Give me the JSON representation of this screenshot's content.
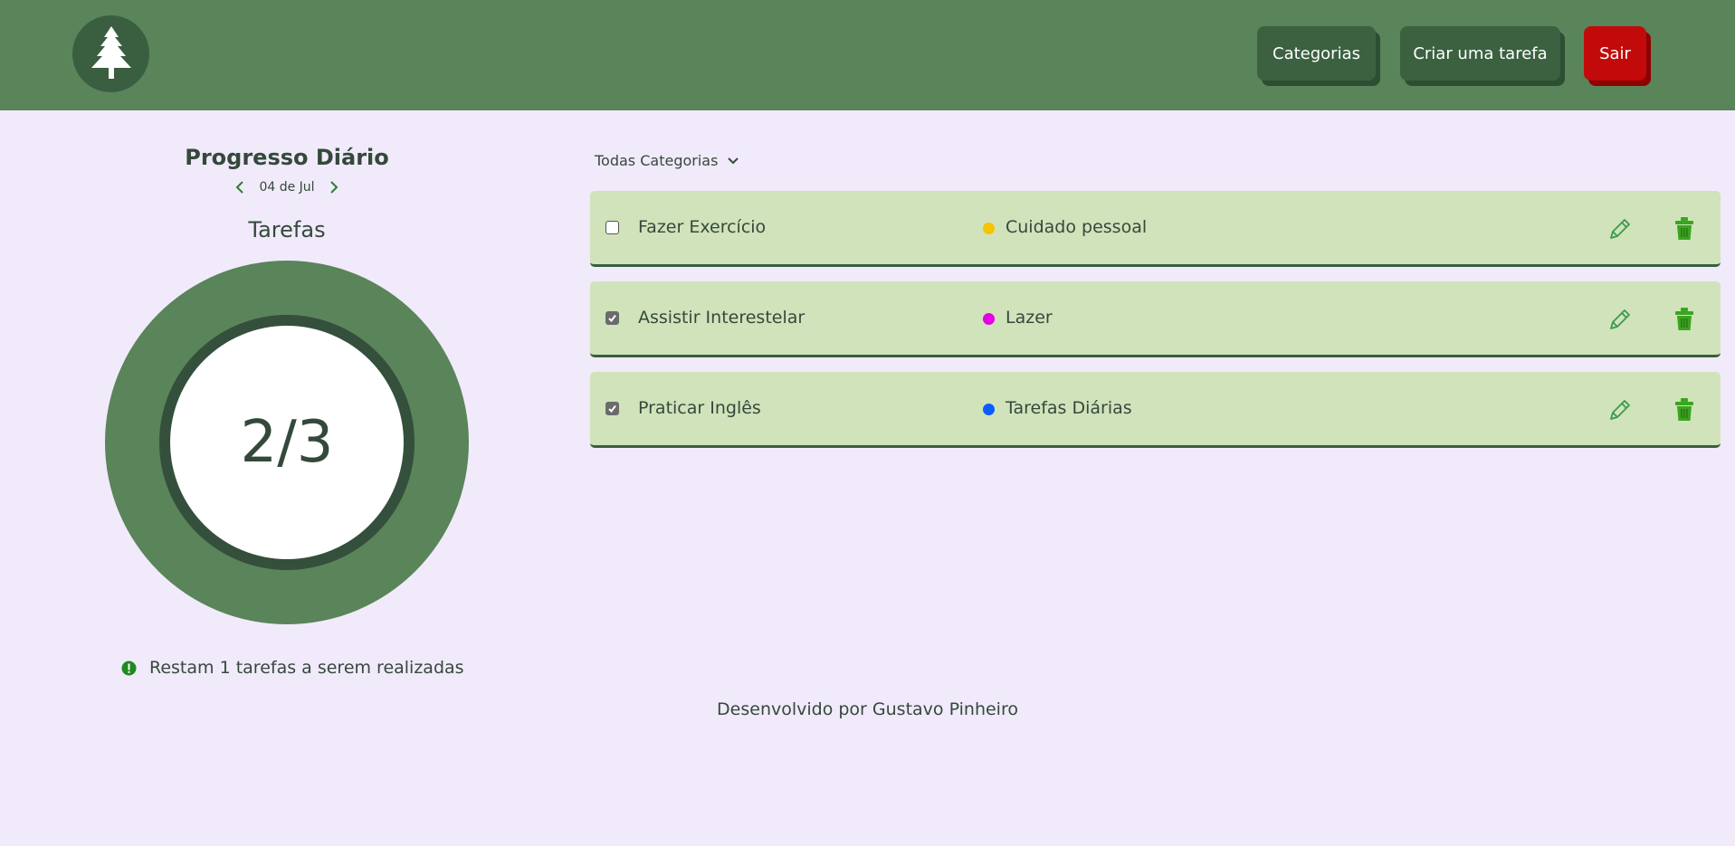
{
  "header": {
    "logo_icon": "pine-tree-icon",
    "buttons": {
      "categories": "Categorias",
      "create_task": "Criar uma tarefa",
      "logout": "Sair"
    }
  },
  "progress": {
    "title": "Progresso Diário",
    "date": "04 de Jul",
    "tasks_label": "Tarefas",
    "count": "2/3",
    "completed": 2,
    "total": 3,
    "remaining_text": "Restam 1 tarefas a serem realizadas"
  },
  "filter": {
    "selected": "Todas Categorias"
  },
  "tasks": [
    {
      "name": "Fazer Exercício",
      "category": "Cuidado pessoal",
      "color": "#f5c400",
      "done": false
    },
    {
      "name": "Assistir Interestelar",
      "category": "Lazer",
      "color": "#e600e6",
      "done": true
    },
    {
      "name": "Praticar Inglês",
      "category": "Tarefas Diárias",
      "color": "#0a5cff",
      "done": true
    }
  ],
  "footer": {
    "text": "Desenvolvido por Gustavo Pinheiro"
  },
  "colors": {
    "header_bg": "#5a8459",
    "dark_green": "#3b6140",
    "danger": "#c20a0a",
    "task_bg": "#d0e3bb",
    "page_bg": "#f1eafb"
  }
}
